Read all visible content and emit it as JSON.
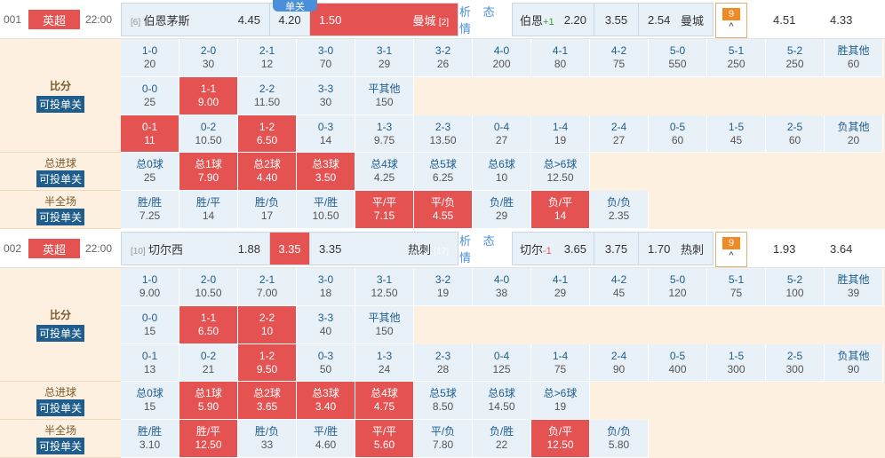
{
  "floating_tag": "单关",
  "matches": [
    {
      "no": "001",
      "league": "英超",
      "time": "22:00",
      "home_rank": "[6]",
      "home": "伯恩茅斯",
      "win": "4.45",
      "draw": "4.20",
      "lose": "1.50",
      "away": "曼城",
      "away_rank": "[2]",
      "analysis": "析 态 情",
      "hcp_team": "伯恩",
      "hcp_val": "+1",
      "hcp_w": "2.20",
      "hcp_d": "3.55",
      "hcp_l": "2.54",
      "hcp_away": "曼城",
      "more_count": "9",
      "more_icon": "^",
      "extra1": "4.51",
      "extra2": "4.33",
      "score_label": "比分",
      "goals_label": "总进球",
      "half_label": "半全场",
      "single_label": "可投单关",
      "score_row1": [
        {
          "n": "1-0",
          "v": "20"
        },
        {
          "n": "2-0",
          "v": "30"
        },
        {
          "n": "2-1",
          "v": "12"
        },
        {
          "n": "3-0",
          "v": "70"
        },
        {
          "n": "3-1",
          "v": "29"
        },
        {
          "n": "3-2",
          "v": "26"
        },
        {
          "n": "4-0",
          "v": "200"
        },
        {
          "n": "4-1",
          "v": "80"
        },
        {
          "n": "4-2",
          "v": "75"
        },
        {
          "n": "5-0",
          "v": "550"
        },
        {
          "n": "5-1",
          "v": "250"
        },
        {
          "n": "5-2",
          "v": "250"
        },
        {
          "n": "胜其他",
          "v": "60"
        }
      ],
      "score_row2": [
        {
          "n": "0-0",
          "v": "25"
        },
        {
          "n": "1-1",
          "v": "9.00"
        },
        {
          "n": "2-2",
          "v": "11.50"
        },
        {
          "n": "3-3",
          "v": "30"
        },
        {
          "n": "平其他",
          "v": "150"
        }
      ],
      "score_row3": [
        {
          "n": "0-1",
          "v": "11"
        },
        {
          "n": "0-2",
          "v": "10.50"
        },
        {
          "n": "1-2",
          "v": "6.50"
        },
        {
          "n": "0-3",
          "v": "14"
        },
        {
          "n": "1-3",
          "v": "9.75"
        },
        {
          "n": "2-3",
          "v": "13.50"
        },
        {
          "n": "0-4",
          "v": "27"
        },
        {
          "n": "1-4",
          "v": "19"
        },
        {
          "n": "2-4",
          "v": "27"
        },
        {
          "n": "0-5",
          "v": "60"
        },
        {
          "n": "1-5",
          "v": "45"
        },
        {
          "n": "2-5",
          "v": "60"
        },
        {
          "n": "负其他",
          "v": "20"
        }
      ],
      "goals": [
        {
          "n": "总0球",
          "v": "25"
        },
        {
          "n": "总1球",
          "v": "7.90"
        },
        {
          "n": "总2球",
          "v": "4.40"
        },
        {
          "n": "总3球",
          "v": "3.50"
        },
        {
          "n": "总4球",
          "v": "4.25"
        },
        {
          "n": "总5球",
          "v": "6.25"
        },
        {
          "n": "总6球",
          "v": "10"
        },
        {
          "n": "总>6球",
          "v": "12.50"
        }
      ],
      "halffull": [
        {
          "n": "胜/胜",
          "v": "7.25"
        },
        {
          "n": "胜/平",
          "v": "14"
        },
        {
          "n": "胜/负",
          "v": "17"
        },
        {
          "n": "平/胜",
          "v": "10.50"
        },
        {
          "n": "平/平",
          "v": "7.15"
        },
        {
          "n": "平/负",
          "v": "4.55"
        },
        {
          "n": "负/胜",
          "v": "29"
        },
        {
          "n": "负/平",
          "v": "14"
        },
        {
          "n": "负/负",
          "v": "2.35"
        }
      ]
    },
    {
      "no": "002",
      "league": "英超",
      "time": "22:00",
      "home_rank": "[10]",
      "home": "切尔西",
      "win": "1.88",
      "draw": "3.35",
      "lose": "3.35",
      "away": "热刺",
      "away_rank": "[17]",
      "analysis": "析 态 情",
      "hcp_team": "切尔",
      "hcp_val": "-1",
      "hcp_w": "3.65",
      "hcp_d": "3.75",
      "hcp_l": "1.70",
      "hcp_away": "热刺",
      "more_count": "9",
      "more_icon": "^",
      "extra1": "1.93",
      "extra2": "3.64",
      "score_label": "比分",
      "goals_label": "总进球",
      "half_label": "半全场",
      "single_label": "可投单关",
      "score_row1": [
        {
          "n": "1-0",
          "v": "9.00"
        },
        {
          "n": "2-0",
          "v": "10.50"
        },
        {
          "n": "2-1",
          "v": "7.00"
        },
        {
          "n": "3-0",
          "v": "18"
        },
        {
          "n": "3-1",
          "v": "12.50"
        },
        {
          "n": "3-2",
          "v": "19"
        },
        {
          "n": "4-0",
          "v": "38"
        },
        {
          "n": "4-1",
          "v": "29"
        },
        {
          "n": "4-2",
          "v": "45"
        },
        {
          "n": "5-0",
          "v": "120"
        },
        {
          "n": "5-1",
          "v": "75"
        },
        {
          "n": "5-2",
          "v": "100"
        },
        {
          "n": "胜其他",
          "v": "39"
        }
      ],
      "score_row2": [
        {
          "n": "0-0",
          "v": "15"
        },
        {
          "n": "1-1",
          "v": "6.50"
        },
        {
          "n": "2-2",
          "v": "10"
        },
        {
          "n": "3-3",
          "v": "40"
        },
        {
          "n": "平其他",
          "v": "150"
        }
      ],
      "score_row3": [
        {
          "n": "0-1",
          "v": "13"
        },
        {
          "n": "0-2",
          "v": "21"
        },
        {
          "n": "1-2",
          "v": "9.50"
        },
        {
          "n": "0-3",
          "v": "50"
        },
        {
          "n": "1-3",
          "v": "24"
        },
        {
          "n": "2-3",
          "v": "28"
        },
        {
          "n": "0-4",
          "v": "125"
        },
        {
          "n": "1-4",
          "v": "75"
        },
        {
          "n": "2-4",
          "v": "90"
        },
        {
          "n": "0-5",
          "v": "400"
        },
        {
          "n": "1-5",
          "v": "300"
        },
        {
          "n": "2-5",
          "v": "300"
        },
        {
          "n": "负其他",
          "v": "90"
        }
      ],
      "goals": [
        {
          "n": "总0球",
          "v": "15"
        },
        {
          "n": "总1球",
          "v": "5.90"
        },
        {
          "n": "总2球",
          "v": "3.65"
        },
        {
          "n": "总3球",
          "v": "3.40"
        },
        {
          "n": "总4球",
          "v": "4.75"
        },
        {
          "n": "总5球",
          "v": "8.50"
        },
        {
          "n": "总6球",
          "v": "14.50"
        },
        {
          "n": "总>6球",
          "v": "19"
        }
      ],
      "halffull": [
        {
          "n": "胜/胜",
          "v": "3.10"
        },
        {
          "n": "胜/平",
          "v": "12.50"
        },
        {
          "n": "胜/负",
          "v": "33"
        },
        {
          "n": "平/胜",
          "v": "4.60"
        },
        {
          "n": "平/平",
          "v": "5.60"
        },
        {
          "n": "平/负",
          "v": "7.80"
        },
        {
          "n": "负/胜",
          "v": "22"
        },
        {
          "n": "负/平",
          "v": "12.50"
        },
        {
          "n": "负/负",
          "v": "5.80"
        }
      ]
    }
  ]
}
